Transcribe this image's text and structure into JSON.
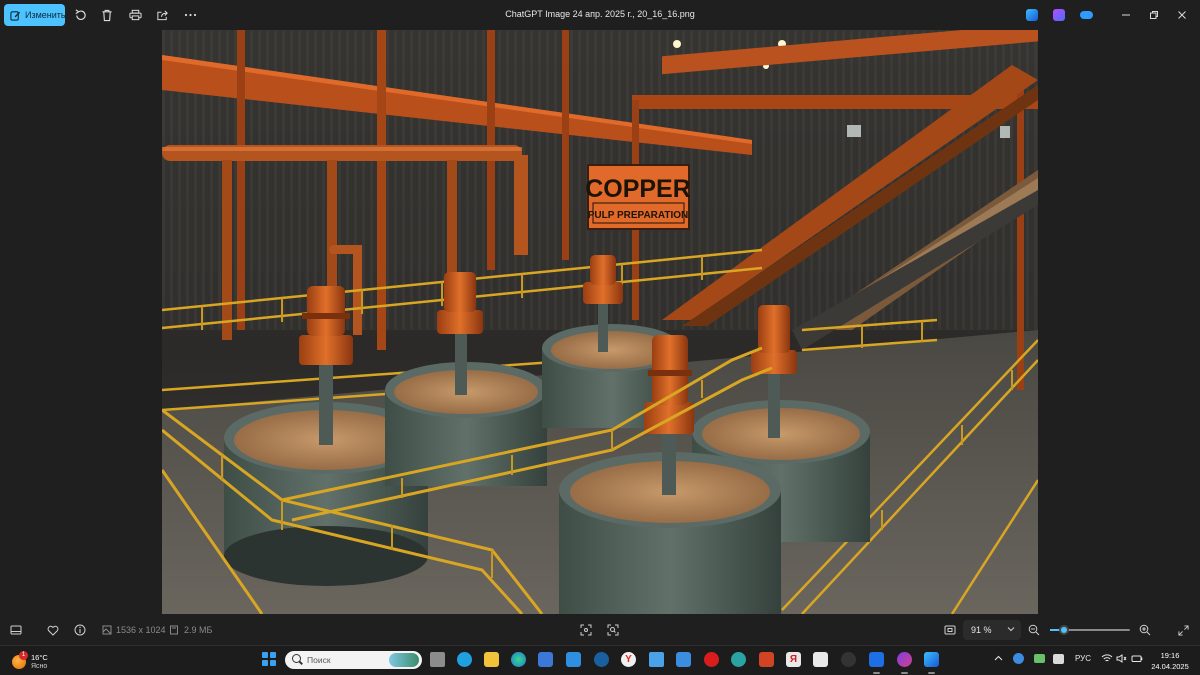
{
  "window": {
    "title": "ChatGPT Image 24 апр. 2025 г., 20_16_16.png",
    "edit_label": "Изменить"
  },
  "toolbar": {
    "icons": [
      "edit-icon",
      "rotate-icon",
      "delete-icon",
      "print-icon",
      "share-icon",
      "more-icon"
    ],
    "right_apps": [
      "clipchamp-icon",
      "designer-icon",
      "onedrive-icon"
    ]
  },
  "photo": {
    "sign_line1": "COPPER",
    "sign_line2": "PULP PREPARATION"
  },
  "infobar": {
    "dimensions": "1536 x 1024",
    "file_size": "2.9 МБ",
    "zoom": "91 %",
    "zoom_fraction": 0.17
  },
  "taskbar": {
    "weather_temp": "16°C",
    "weather_cond": "Ясно",
    "weather_badge": "1",
    "search_placeholder": "Поиск",
    "language": "РУС",
    "time": "19:16",
    "date": "24.04.2025"
  },
  "colors": {
    "accent": "#4cc2ff",
    "background": "#1f1f1f",
    "taskbar": "#1c1c1c"
  }
}
